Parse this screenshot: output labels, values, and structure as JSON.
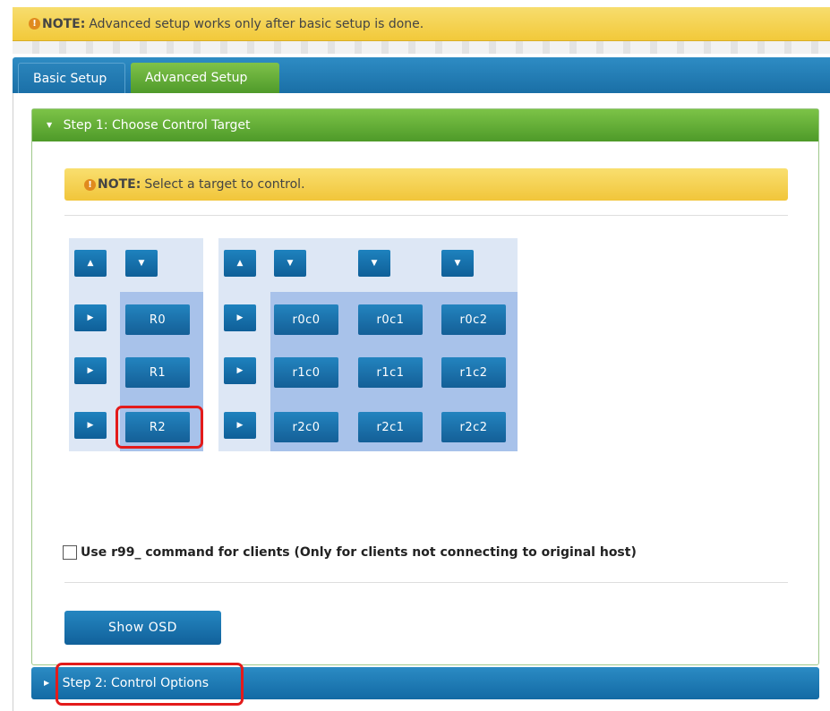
{
  "top_note": {
    "icon": "warning-icon",
    "label": "NOTE:",
    "text": "Advanced setup works only after basic setup is done."
  },
  "tabs": [
    {
      "label": "Basic Setup",
      "active": false
    },
    {
      "label": "Advanced Setup",
      "active": true
    }
  ],
  "step1": {
    "title": "Step 1: Choose Control Target",
    "note": {
      "icon": "warning-icon",
      "label": "NOTE:",
      "text": "Select a target to control."
    },
    "rows": [
      "R0",
      "R1",
      "R2"
    ],
    "cells": [
      [
        "r0c0",
        "r0c1",
        "r0c2"
      ],
      [
        "r1c0",
        "r1c1",
        "r1c2"
      ],
      [
        "r2c0",
        "r2c1",
        "r2c2"
      ]
    ],
    "selected_row": "R2",
    "checkbox_label": "Use r99_ command for clients (Only for clients not connecting to original host)",
    "checkbox_checked": false,
    "show_osd_label": "Show OSD"
  },
  "step2": {
    "title": "Step 2: Control Options"
  },
  "colors": {
    "accent_green": "#5aa533",
    "accent_blue": "#1a70a8",
    "note_yellow": "#f2c93a",
    "highlight_red": "#e31b1b"
  }
}
